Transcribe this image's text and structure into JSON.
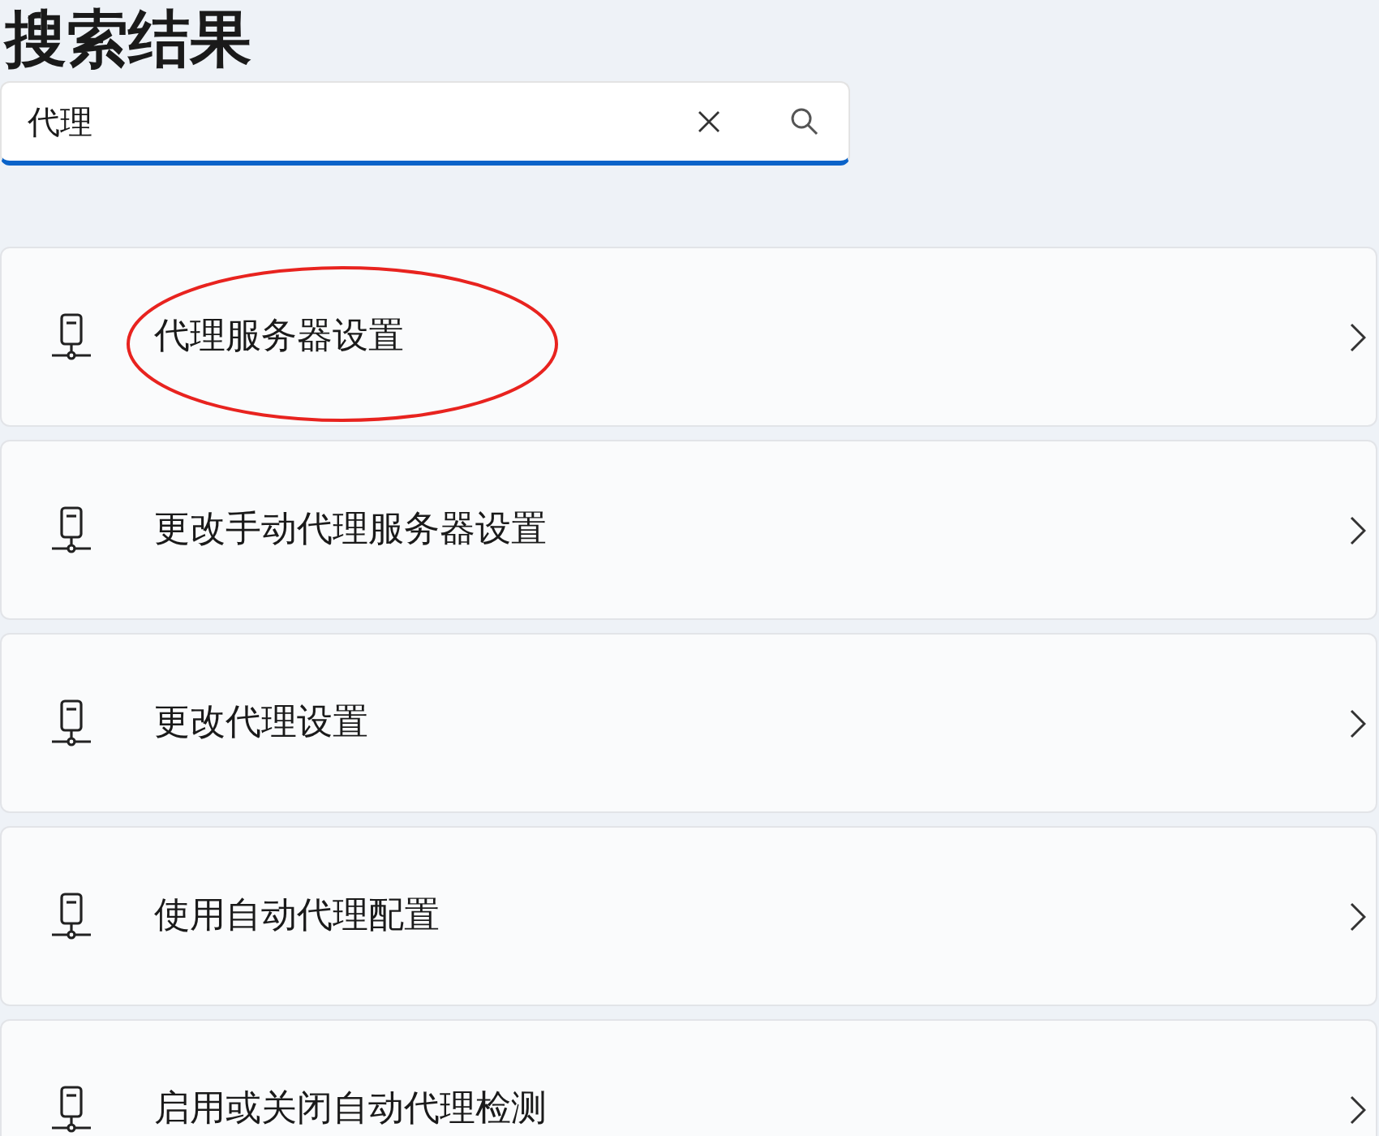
{
  "title": "搜索结果",
  "search": {
    "value": "代理"
  },
  "results": [
    {
      "label": "代理服务器设置",
      "circled": true
    },
    {
      "label": "更改手动代理服务器设置",
      "circled": false
    },
    {
      "label": "更改代理设置",
      "circled": false
    },
    {
      "label": "使用自动代理配置",
      "circled": false
    },
    {
      "label": "启用或关闭自动代理检测",
      "circled": false
    }
  ]
}
